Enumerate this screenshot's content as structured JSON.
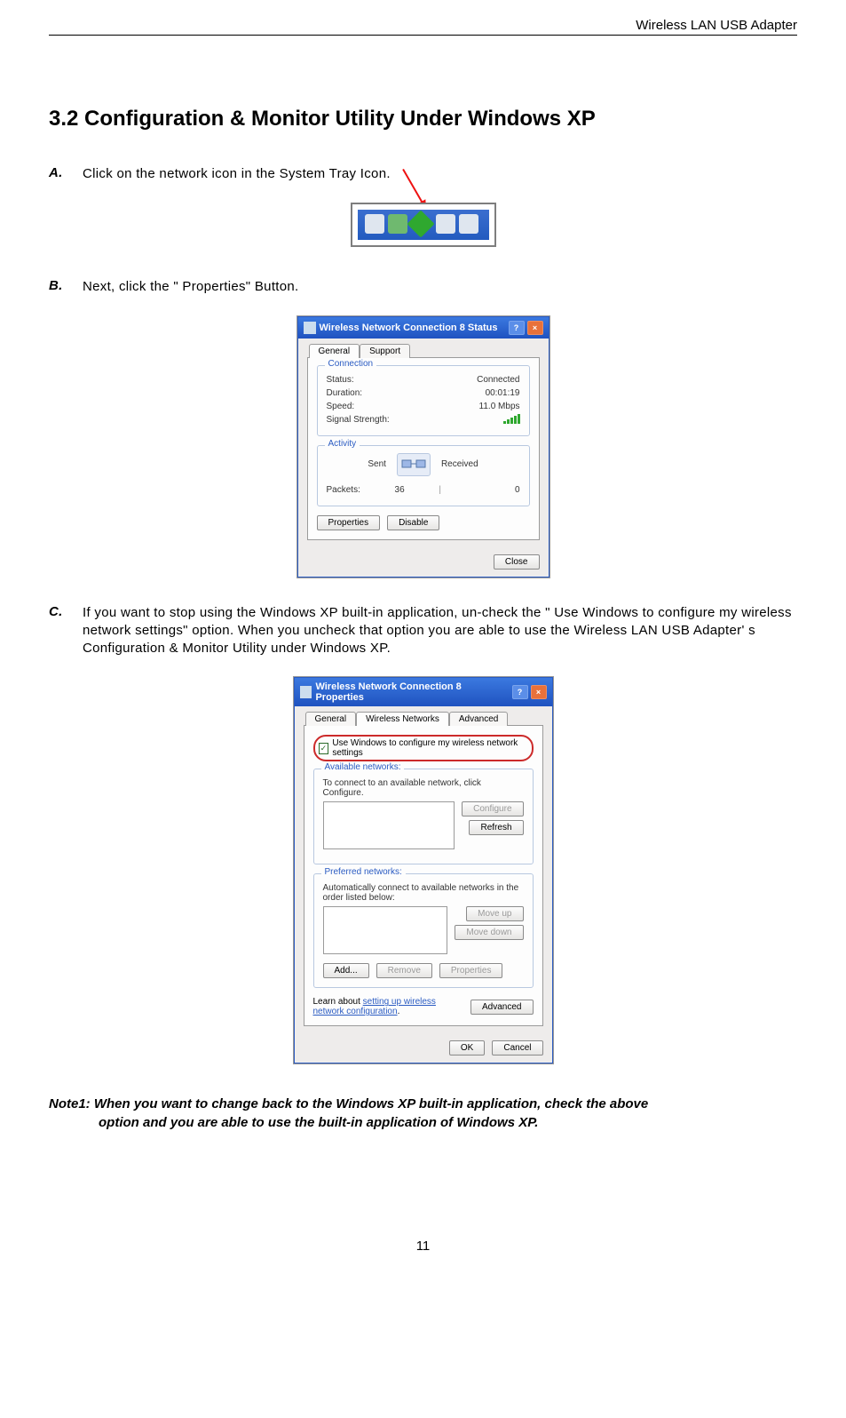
{
  "header": {
    "doc_title": "Wireless LAN USB Adapter"
  },
  "section": {
    "title": "3.2 Configuration & Monitor Utility Under Windows XP"
  },
  "items": {
    "a": {
      "label": "A.",
      "text": "Click on the network icon in the System Tray Icon."
    },
    "b": {
      "label": "B.",
      "text": "Next, click the \" Properties\"  Button."
    },
    "c": {
      "label": "C.",
      "text": "If you want to stop using the Windows XP built-in application, un-check the \" Use Windows to configure my wireless network settings\"  option. When you uncheck that option you are able to use the Wireless LAN USB Adapter' s Configuration & Monitor Utility under Windows XP."
    }
  },
  "status_dialog": {
    "title": "Wireless Network Connection 8 Status",
    "tabs": {
      "general": "General",
      "support": "Support"
    },
    "connection": {
      "group": "Connection",
      "status_label": "Status:",
      "status_value": "Connected",
      "duration_label": "Duration:",
      "duration_value": "00:01:19",
      "speed_label": "Speed:",
      "speed_value": "11.0 Mbps",
      "signal_label": "Signal Strength:"
    },
    "activity": {
      "group": "Activity",
      "sent": "Sent",
      "received": "Received",
      "packets_label": "Packets:",
      "sent_value": "36",
      "received_value": "0"
    },
    "buttons": {
      "properties": "Properties",
      "disable": "Disable",
      "close": "Close"
    }
  },
  "props_dialog": {
    "title": "Wireless Network Connection 8 Properties",
    "tabs": {
      "general": "General",
      "wireless": "Wireless Networks",
      "advanced": "Advanced"
    },
    "checkbox": "Use Windows to configure my wireless network settings",
    "available": {
      "group": "Available networks:",
      "note": "To connect to an available network, click Configure.",
      "configure": "Configure",
      "refresh": "Refresh"
    },
    "preferred": {
      "group": "Preferred networks:",
      "note": "Automatically connect to available networks in the order listed below:",
      "moveup": "Move up",
      "movedown": "Move down",
      "add": "Add...",
      "remove": "Remove",
      "properties": "Properties"
    },
    "learn_prefix": "Learn about ",
    "learn_link": "setting up wireless network configuration",
    "learn_suffix": ".",
    "advanced_btn": "Advanced",
    "ok": "OK",
    "cancel": "Cancel"
  },
  "note": {
    "prefix": "Note1: ",
    "line1": "When you want to change back to the Windows XP built-in application, check the above",
    "line2": "option and you are able to use the built-in application of Windows XP."
  },
  "page_number": "11"
}
